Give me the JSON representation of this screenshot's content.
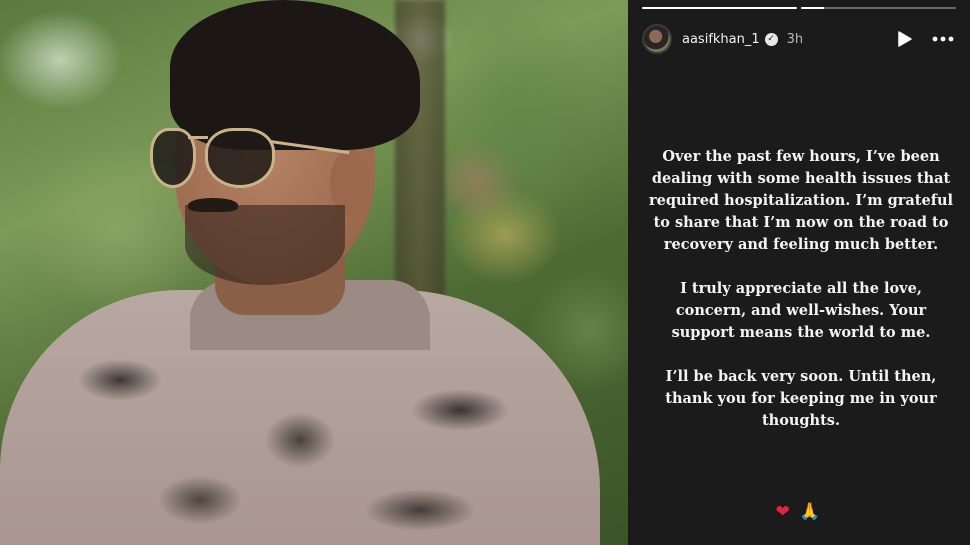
{
  "story": {
    "progress": [
      1.0,
      0.15
    ],
    "username": "aasifkhan_1",
    "time": "3h",
    "icons": {
      "verified": "verified-badge-icon",
      "play": "play-icon",
      "more": "more-options-icon"
    },
    "message": [
      "Over the past few hours, I’ve been dealing with some health issues that required hospitalization. I’m grateful to share that I’m now on the road to recovery and feeling much better.",
      "I truly appreciate all the love, concern, and well-wishes. Your support means the world to me.",
      "I’ll be back very soon. Until then, thank you for keeping me in your thoughts."
    ],
    "emojis": {
      "heart": "❤",
      "hands": "🙏"
    }
  },
  "colors": {
    "panel_bg": "#1b1b1b",
    "text": "#f4f4f4",
    "heart": "#e0243a"
  }
}
